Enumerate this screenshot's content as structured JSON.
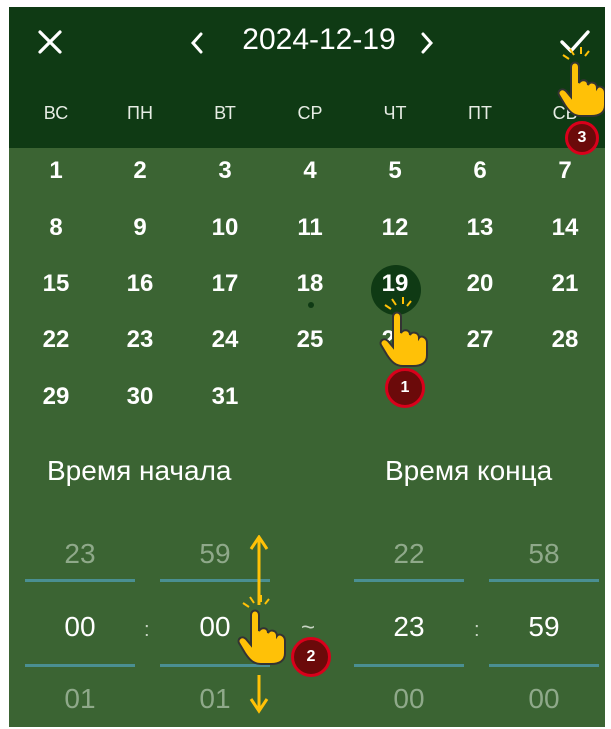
{
  "header": {
    "close_icon": "close-icon",
    "prev_icon": "chevron-left-icon",
    "title": "2024-12-19",
    "next_icon": "chevron-right-icon",
    "confirm_icon": "check-icon"
  },
  "weekdays": [
    "ВС",
    "ПН",
    "ВТ",
    "СР",
    "ЧТ",
    "ПТ",
    "СБ"
  ],
  "calendar": {
    "weeks": [
      [
        "1",
        "2",
        "3",
        "4",
        "5",
        "6",
        "7"
      ],
      [
        "8",
        "9",
        "10",
        "11",
        "12",
        "13",
        "14"
      ],
      [
        "15",
        "16",
        "17",
        "18",
        "19",
        "20",
        "21"
      ],
      [
        "22",
        "23",
        "24",
        "25",
        "26",
        "27",
        "28"
      ],
      [
        "29",
        "30",
        "31"
      ]
    ],
    "selected_day": "19",
    "marked_day": "18"
  },
  "time": {
    "start_label": "Время начала",
    "end_label": "Время конца",
    "start": {
      "hour_prev": "23",
      "hour": "00",
      "hour_next": "01",
      "min_prev": "59",
      "min": "00",
      "min_next": "01"
    },
    "end": {
      "hour_prev": "22",
      "hour": "23",
      "hour_next": "00",
      "min_prev": "58",
      "min": "59",
      "min_next": "00"
    },
    "colon": ":",
    "range_sep": "~"
  },
  "annotations": {
    "step1": "1",
    "step2": "2",
    "step3": "3"
  },
  "colors": {
    "header_bg": "#0f3a14",
    "body_bg": "#3b6433",
    "wheel_line": "#4a8f92",
    "badge": "#d9001b",
    "hand": "#ffc107"
  }
}
